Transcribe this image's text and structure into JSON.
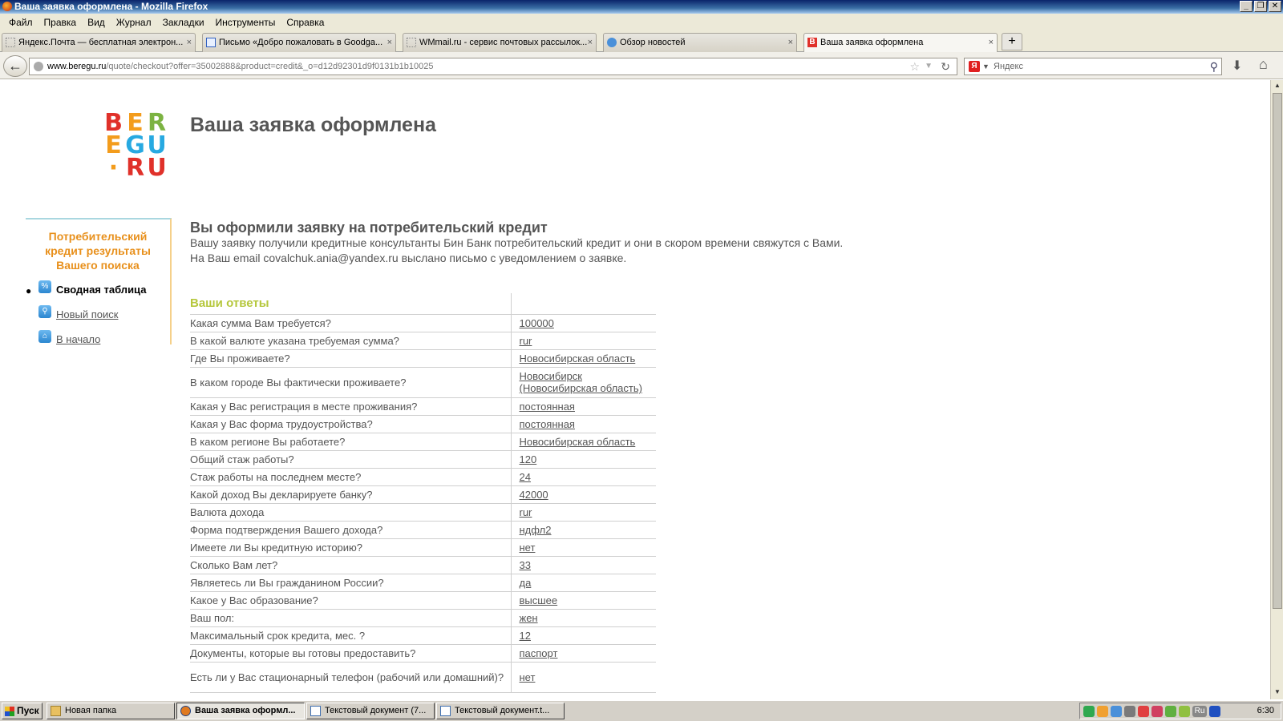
{
  "window": {
    "title": "Ваша заявка оформлена - Mozilla Firefox",
    "buttons": [
      "_",
      "❐",
      "✕"
    ]
  },
  "menu": [
    "Файл",
    "Правка",
    "Вид",
    "Журнал",
    "Закладки",
    "Инструменты",
    "Справка"
  ],
  "tabs": [
    {
      "label": "Яндекс.Почта — бесплатная электрон...",
      "close": "×"
    },
    {
      "label": "Письмо «Добро пожаловать в Goodga...",
      "close": "×"
    },
    {
      "label": "WMmail.ru - сервис почтовых рассылок...",
      "close": "×"
    },
    {
      "label": "Обзор новостей",
      "close": "×"
    },
    {
      "label": "Ваша заявка оформлена",
      "close": "×"
    }
  ],
  "newtab": "+",
  "nav": {
    "url_domain": "www.beregu.ru",
    "url_path": "/quote/checkout?offer=35002888&product=credit&_o=d12d92301d9f0131b1b10025",
    "search_placeholder": "Яндекс",
    "search_engine_letter": "Я"
  },
  "logo": {
    "row1": [
      "B",
      "E",
      "R"
    ],
    "row2": [
      "E",
      "G",
      "U"
    ],
    "row3": [
      "·",
      "R",
      "U"
    ],
    "colors": {
      "B": "#e0312a",
      "E": "#f39c1c",
      "R": "#7cb342",
      "E2": "#f39c1c",
      "G": "#27a9e1",
      "U": "#27a9e1",
      "dot": "#f39c1c",
      "R2": "#e0312a",
      "U2": "#e0312a"
    }
  },
  "page_title": "Ваша заявка оформлена",
  "sidebar": {
    "title": "Потребительский кредит результаты Вашего поиска",
    "items": [
      {
        "label": "Сводная таблица",
        "icon": "%",
        "active": true
      },
      {
        "label": "Новый поиск",
        "icon": "🔍",
        "active": false
      },
      {
        "label": "В начало",
        "icon": "⌂",
        "active": false
      }
    ]
  },
  "content": {
    "heading": "Вы оформили заявку на потребительский кредит",
    "line1": "Вашу заявку получили кредитные консультанты Бин Банк потребительский кредит и они в скором времени свяжутся с Вами.",
    "line2": "На Ваш email covalchuk.ania@yandex.ru выслано письмо с уведомлением о заявке."
  },
  "answers_header": "Ваши ответы",
  "answers": [
    {
      "q": "Какая сумма Вам требуется?",
      "a": "100000"
    },
    {
      "q": "В какой валюте указана требуемая сумма?",
      "a": "rur"
    },
    {
      "q": "Где Вы проживаете?",
      "a": "Новосибирская область"
    },
    {
      "q": "В каком городе Вы фактически проживаете?",
      "a": "Новосибирск (Новосибирская область)"
    },
    {
      "q": "Какая у Вас регистрация в месте проживания?",
      "a": "постоянная"
    },
    {
      "q": "Какая у Вас форма трудоустройства?",
      "a": "постоянная"
    },
    {
      "q": "В каком регионе Вы работаете?",
      "a": "Новосибирская область"
    },
    {
      "q": "Общий стаж работы?",
      "a": "120"
    },
    {
      "q": "Стаж работы на последнем месте?",
      "a": "24"
    },
    {
      "q": "Какой доход Вы декларируете банку?",
      "a": "42000"
    },
    {
      "q": "Валюта дохода",
      "a": "rur"
    },
    {
      "q": "Форма подтверждения Вашего дохода?",
      "a": "ндфл2"
    },
    {
      "q": "Имеете ли Вы кредитную историю?",
      "a": "нет"
    },
    {
      "q": "Сколько Вам лет?",
      "a": "33"
    },
    {
      "q": "Являетесь ли Вы гражданином России?",
      "a": "да"
    },
    {
      "q": "Какое у Вас образование?",
      "a": "высшее"
    },
    {
      "q": "Ваш пол:",
      "a": "жен"
    },
    {
      "q": "Максимальный срок кредита, мес. ?",
      "a": "12"
    },
    {
      "q": "Документы, которые вы готовы предоставить?",
      "a": "паспорт"
    },
    {
      "q": "Есть ли у Вас стационарный телефон (рабочий или домашний)?",
      "a": "нет"
    }
  ],
  "taskbar": {
    "start": "Пуск",
    "items": [
      {
        "label": "Новая папка",
        "active": false
      },
      {
        "label": "Ваша заявка оформл...",
        "active": true
      },
      {
        "label": "Текстовый документ (7...",
        "active": false
      },
      {
        "label": "Текстовый документ.t...",
        "active": false
      }
    ],
    "lang": "Ru",
    "clock": "6:30"
  }
}
